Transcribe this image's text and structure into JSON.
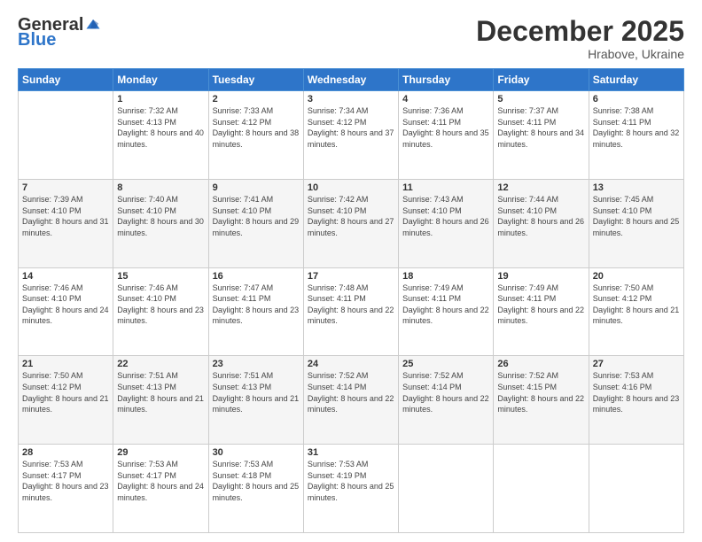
{
  "logo": {
    "general": "General",
    "blue": "Blue"
  },
  "title": {
    "month_year": "December 2025",
    "location": "Hrabove, Ukraine"
  },
  "days_header": [
    "Sunday",
    "Monday",
    "Tuesday",
    "Wednesday",
    "Thursday",
    "Friday",
    "Saturday"
  ],
  "weeks": [
    [
      {
        "day": "",
        "sunrise": "",
        "sunset": "",
        "daylight": ""
      },
      {
        "day": "1",
        "sunrise": "Sunrise: 7:32 AM",
        "sunset": "Sunset: 4:13 PM",
        "daylight": "Daylight: 8 hours and 40 minutes."
      },
      {
        "day": "2",
        "sunrise": "Sunrise: 7:33 AM",
        "sunset": "Sunset: 4:12 PM",
        "daylight": "Daylight: 8 hours and 38 minutes."
      },
      {
        "day": "3",
        "sunrise": "Sunrise: 7:34 AM",
        "sunset": "Sunset: 4:12 PM",
        "daylight": "Daylight: 8 hours and 37 minutes."
      },
      {
        "day": "4",
        "sunrise": "Sunrise: 7:36 AM",
        "sunset": "Sunset: 4:11 PM",
        "daylight": "Daylight: 8 hours and 35 minutes."
      },
      {
        "day": "5",
        "sunrise": "Sunrise: 7:37 AM",
        "sunset": "Sunset: 4:11 PM",
        "daylight": "Daylight: 8 hours and 34 minutes."
      },
      {
        "day": "6",
        "sunrise": "Sunrise: 7:38 AM",
        "sunset": "Sunset: 4:11 PM",
        "daylight": "Daylight: 8 hours and 32 minutes."
      }
    ],
    [
      {
        "day": "7",
        "sunrise": "Sunrise: 7:39 AM",
        "sunset": "Sunset: 4:10 PM",
        "daylight": "Daylight: 8 hours and 31 minutes."
      },
      {
        "day": "8",
        "sunrise": "Sunrise: 7:40 AM",
        "sunset": "Sunset: 4:10 PM",
        "daylight": "Daylight: 8 hours and 30 minutes."
      },
      {
        "day": "9",
        "sunrise": "Sunrise: 7:41 AM",
        "sunset": "Sunset: 4:10 PM",
        "daylight": "Daylight: 8 hours and 29 minutes."
      },
      {
        "day": "10",
        "sunrise": "Sunrise: 7:42 AM",
        "sunset": "Sunset: 4:10 PM",
        "daylight": "Daylight: 8 hours and 27 minutes."
      },
      {
        "day": "11",
        "sunrise": "Sunrise: 7:43 AM",
        "sunset": "Sunset: 4:10 PM",
        "daylight": "Daylight: 8 hours and 26 minutes."
      },
      {
        "day": "12",
        "sunrise": "Sunrise: 7:44 AM",
        "sunset": "Sunset: 4:10 PM",
        "daylight": "Daylight: 8 hours and 26 minutes."
      },
      {
        "day": "13",
        "sunrise": "Sunrise: 7:45 AM",
        "sunset": "Sunset: 4:10 PM",
        "daylight": "Daylight: 8 hours and 25 minutes."
      }
    ],
    [
      {
        "day": "14",
        "sunrise": "Sunrise: 7:46 AM",
        "sunset": "Sunset: 4:10 PM",
        "daylight": "Daylight: 8 hours and 24 minutes."
      },
      {
        "day": "15",
        "sunrise": "Sunrise: 7:46 AM",
        "sunset": "Sunset: 4:10 PM",
        "daylight": "Daylight: 8 hours and 23 minutes."
      },
      {
        "day": "16",
        "sunrise": "Sunrise: 7:47 AM",
        "sunset": "Sunset: 4:11 PM",
        "daylight": "Daylight: 8 hours and 23 minutes."
      },
      {
        "day": "17",
        "sunrise": "Sunrise: 7:48 AM",
        "sunset": "Sunset: 4:11 PM",
        "daylight": "Daylight: 8 hours and 22 minutes."
      },
      {
        "day": "18",
        "sunrise": "Sunrise: 7:49 AM",
        "sunset": "Sunset: 4:11 PM",
        "daylight": "Daylight: 8 hours and 22 minutes."
      },
      {
        "day": "19",
        "sunrise": "Sunrise: 7:49 AM",
        "sunset": "Sunset: 4:11 PM",
        "daylight": "Daylight: 8 hours and 22 minutes."
      },
      {
        "day": "20",
        "sunrise": "Sunrise: 7:50 AM",
        "sunset": "Sunset: 4:12 PM",
        "daylight": "Daylight: 8 hours and 21 minutes."
      }
    ],
    [
      {
        "day": "21",
        "sunrise": "Sunrise: 7:50 AM",
        "sunset": "Sunset: 4:12 PM",
        "daylight": "Daylight: 8 hours and 21 minutes."
      },
      {
        "day": "22",
        "sunrise": "Sunrise: 7:51 AM",
        "sunset": "Sunset: 4:13 PM",
        "daylight": "Daylight: 8 hours and 21 minutes."
      },
      {
        "day": "23",
        "sunrise": "Sunrise: 7:51 AM",
        "sunset": "Sunset: 4:13 PM",
        "daylight": "Daylight: 8 hours and 21 minutes."
      },
      {
        "day": "24",
        "sunrise": "Sunrise: 7:52 AM",
        "sunset": "Sunset: 4:14 PM",
        "daylight": "Daylight: 8 hours and 22 minutes."
      },
      {
        "day": "25",
        "sunrise": "Sunrise: 7:52 AM",
        "sunset": "Sunset: 4:14 PM",
        "daylight": "Daylight: 8 hours and 22 minutes."
      },
      {
        "day": "26",
        "sunrise": "Sunrise: 7:52 AM",
        "sunset": "Sunset: 4:15 PM",
        "daylight": "Daylight: 8 hours and 22 minutes."
      },
      {
        "day": "27",
        "sunrise": "Sunrise: 7:53 AM",
        "sunset": "Sunset: 4:16 PM",
        "daylight": "Daylight: 8 hours and 23 minutes."
      }
    ],
    [
      {
        "day": "28",
        "sunrise": "Sunrise: 7:53 AM",
        "sunset": "Sunset: 4:17 PM",
        "daylight": "Daylight: 8 hours and 23 minutes."
      },
      {
        "day": "29",
        "sunrise": "Sunrise: 7:53 AM",
        "sunset": "Sunset: 4:17 PM",
        "daylight": "Daylight: 8 hours and 24 minutes."
      },
      {
        "day": "30",
        "sunrise": "Sunrise: 7:53 AM",
        "sunset": "Sunset: 4:18 PM",
        "daylight": "Daylight: 8 hours and 25 minutes."
      },
      {
        "day": "31",
        "sunrise": "Sunrise: 7:53 AM",
        "sunset": "Sunset: 4:19 PM",
        "daylight": "Daylight: 8 hours and 25 minutes."
      },
      {
        "day": "",
        "sunrise": "",
        "sunset": "",
        "daylight": ""
      },
      {
        "day": "",
        "sunrise": "",
        "sunset": "",
        "daylight": ""
      },
      {
        "day": "",
        "sunrise": "",
        "sunset": "",
        "daylight": ""
      }
    ]
  ]
}
